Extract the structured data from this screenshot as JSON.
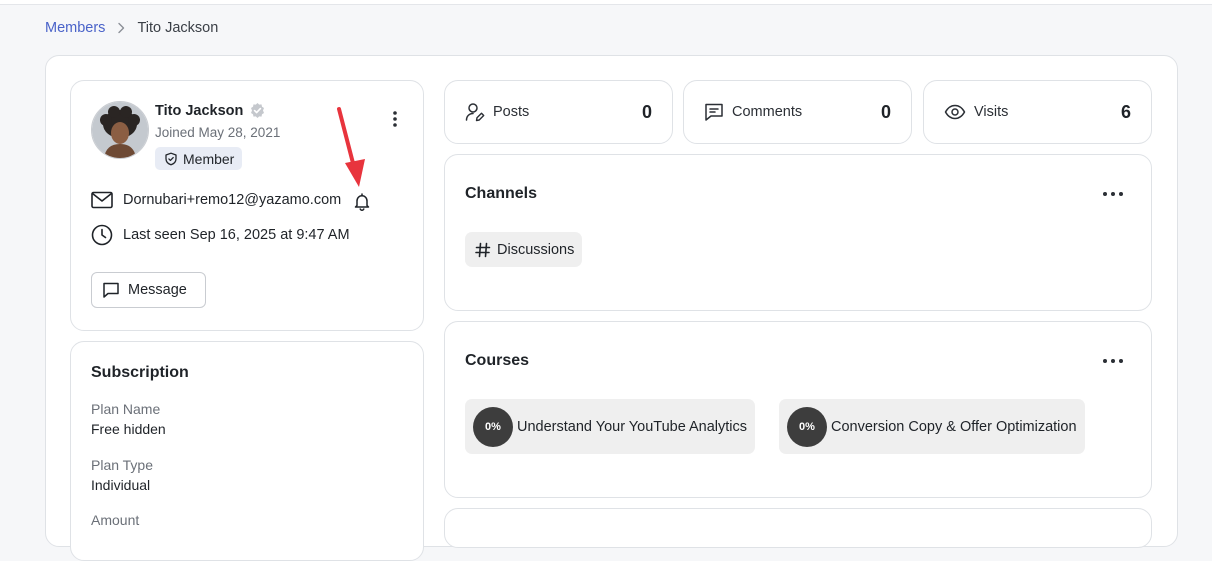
{
  "breadcrumb": {
    "parent": "Members",
    "current": "Tito Jackson"
  },
  "profile": {
    "name": "Tito Jackson",
    "joined": "Joined May 28, 2021",
    "role": "Member",
    "email": "Dornubari+remo12@yazamo.com",
    "last_seen": "Last seen Sep 16, 2025 at 9:47 AM",
    "message_label": "Message"
  },
  "subscription": {
    "title": "Subscription",
    "fields": [
      {
        "label": "Plan Name",
        "value": "Free hidden"
      },
      {
        "label": "Plan Type",
        "value": "Individual"
      },
      {
        "label": "Amount",
        "value": ""
      }
    ]
  },
  "stats": [
    {
      "label": "Posts",
      "value": "0",
      "icon": "user-pen-icon"
    },
    {
      "label": "Comments",
      "value": "0",
      "icon": "comment-icon"
    },
    {
      "label": "Visits",
      "value": "6",
      "icon": "eye-icon"
    }
  ],
  "channels": {
    "title": "Channels",
    "items": [
      {
        "label": "Discussions",
        "icon": "hash-icon"
      }
    ]
  },
  "courses": {
    "title": "Courses",
    "items": [
      {
        "progress": "0%",
        "label": "Understand Your YouTube Analytics"
      },
      {
        "progress": "0%",
        "label": "Conversion Copy & Offer Optimization"
      }
    ]
  },
  "colors": {
    "link": "#4a63c9",
    "badge_bg": "#e8ecf5",
    "arrow": "#e8343d",
    "progress_bg": "#3d3d3d"
  }
}
